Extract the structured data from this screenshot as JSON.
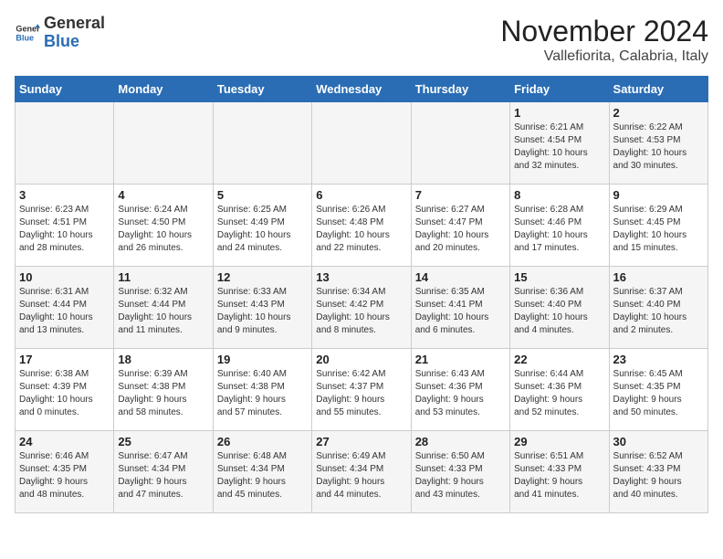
{
  "header": {
    "logo_general": "General",
    "logo_blue": "Blue",
    "month_title": "November 2024",
    "subtitle": "Vallefiorita, Calabria, Italy"
  },
  "days_of_week": [
    "Sunday",
    "Monday",
    "Tuesday",
    "Wednesday",
    "Thursday",
    "Friday",
    "Saturday"
  ],
  "weeks": [
    [
      {
        "day": "",
        "info": ""
      },
      {
        "day": "",
        "info": ""
      },
      {
        "day": "",
        "info": ""
      },
      {
        "day": "",
        "info": ""
      },
      {
        "day": "",
        "info": ""
      },
      {
        "day": "1",
        "info": "Sunrise: 6:21 AM\nSunset: 4:54 PM\nDaylight: 10 hours\nand 32 minutes."
      },
      {
        "day": "2",
        "info": "Sunrise: 6:22 AM\nSunset: 4:53 PM\nDaylight: 10 hours\nand 30 minutes."
      }
    ],
    [
      {
        "day": "3",
        "info": "Sunrise: 6:23 AM\nSunset: 4:51 PM\nDaylight: 10 hours\nand 28 minutes."
      },
      {
        "day": "4",
        "info": "Sunrise: 6:24 AM\nSunset: 4:50 PM\nDaylight: 10 hours\nand 26 minutes."
      },
      {
        "day": "5",
        "info": "Sunrise: 6:25 AM\nSunset: 4:49 PM\nDaylight: 10 hours\nand 24 minutes."
      },
      {
        "day": "6",
        "info": "Sunrise: 6:26 AM\nSunset: 4:48 PM\nDaylight: 10 hours\nand 22 minutes."
      },
      {
        "day": "7",
        "info": "Sunrise: 6:27 AM\nSunset: 4:47 PM\nDaylight: 10 hours\nand 20 minutes."
      },
      {
        "day": "8",
        "info": "Sunrise: 6:28 AM\nSunset: 4:46 PM\nDaylight: 10 hours\nand 17 minutes."
      },
      {
        "day": "9",
        "info": "Sunrise: 6:29 AM\nSunset: 4:45 PM\nDaylight: 10 hours\nand 15 minutes."
      }
    ],
    [
      {
        "day": "10",
        "info": "Sunrise: 6:31 AM\nSunset: 4:44 PM\nDaylight: 10 hours\nand 13 minutes."
      },
      {
        "day": "11",
        "info": "Sunrise: 6:32 AM\nSunset: 4:44 PM\nDaylight: 10 hours\nand 11 minutes."
      },
      {
        "day": "12",
        "info": "Sunrise: 6:33 AM\nSunset: 4:43 PM\nDaylight: 10 hours\nand 9 minutes."
      },
      {
        "day": "13",
        "info": "Sunrise: 6:34 AM\nSunset: 4:42 PM\nDaylight: 10 hours\nand 8 minutes."
      },
      {
        "day": "14",
        "info": "Sunrise: 6:35 AM\nSunset: 4:41 PM\nDaylight: 10 hours\nand 6 minutes."
      },
      {
        "day": "15",
        "info": "Sunrise: 6:36 AM\nSunset: 4:40 PM\nDaylight: 10 hours\nand 4 minutes."
      },
      {
        "day": "16",
        "info": "Sunrise: 6:37 AM\nSunset: 4:40 PM\nDaylight: 10 hours\nand 2 minutes."
      }
    ],
    [
      {
        "day": "17",
        "info": "Sunrise: 6:38 AM\nSunset: 4:39 PM\nDaylight: 10 hours\nand 0 minutes."
      },
      {
        "day": "18",
        "info": "Sunrise: 6:39 AM\nSunset: 4:38 PM\nDaylight: 9 hours\nand 58 minutes."
      },
      {
        "day": "19",
        "info": "Sunrise: 6:40 AM\nSunset: 4:38 PM\nDaylight: 9 hours\nand 57 minutes."
      },
      {
        "day": "20",
        "info": "Sunrise: 6:42 AM\nSunset: 4:37 PM\nDaylight: 9 hours\nand 55 minutes."
      },
      {
        "day": "21",
        "info": "Sunrise: 6:43 AM\nSunset: 4:36 PM\nDaylight: 9 hours\nand 53 minutes."
      },
      {
        "day": "22",
        "info": "Sunrise: 6:44 AM\nSunset: 4:36 PM\nDaylight: 9 hours\nand 52 minutes."
      },
      {
        "day": "23",
        "info": "Sunrise: 6:45 AM\nSunset: 4:35 PM\nDaylight: 9 hours\nand 50 minutes."
      }
    ],
    [
      {
        "day": "24",
        "info": "Sunrise: 6:46 AM\nSunset: 4:35 PM\nDaylight: 9 hours\nand 48 minutes."
      },
      {
        "day": "25",
        "info": "Sunrise: 6:47 AM\nSunset: 4:34 PM\nDaylight: 9 hours\nand 47 minutes."
      },
      {
        "day": "26",
        "info": "Sunrise: 6:48 AM\nSunset: 4:34 PM\nDaylight: 9 hours\nand 45 minutes."
      },
      {
        "day": "27",
        "info": "Sunrise: 6:49 AM\nSunset: 4:34 PM\nDaylight: 9 hours\nand 44 minutes."
      },
      {
        "day": "28",
        "info": "Sunrise: 6:50 AM\nSunset: 4:33 PM\nDaylight: 9 hours\nand 43 minutes."
      },
      {
        "day": "29",
        "info": "Sunrise: 6:51 AM\nSunset: 4:33 PM\nDaylight: 9 hours\nand 41 minutes."
      },
      {
        "day": "30",
        "info": "Sunrise: 6:52 AM\nSunset: 4:33 PM\nDaylight: 9 hours\nand 40 minutes."
      }
    ]
  ]
}
